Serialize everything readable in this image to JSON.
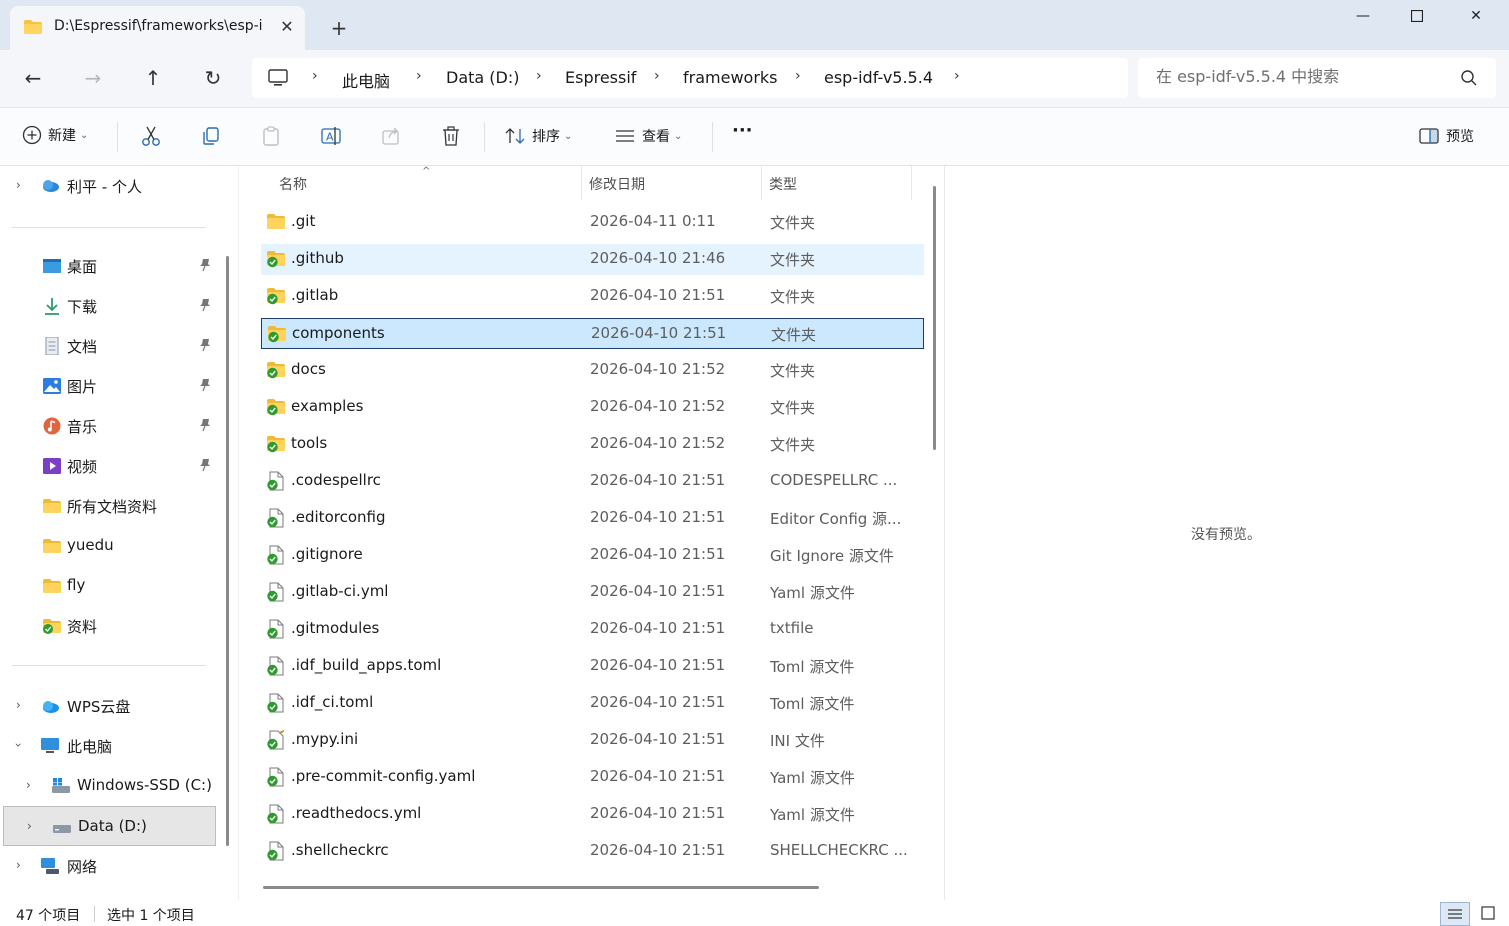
{
  "window": {
    "tab_title": "D:\\Espressif\\frameworks\\esp-i",
    "tab_close": "✕",
    "new_tab": "+",
    "minimize": "—",
    "maximize": "☐",
    "close": "✕"
  },
  "nav": {
    "back": "←",
    "forward": "→",
    "up": "↑",
    "refresh": "↻"
  },
  "breadcrumb": {
    "items": [
      "此电脑",
      "Data (D:)",
      "Espressif",
      "frameworks",
      "esp-idf-v5.5.4"
    ],
    "separator": "›"
  },
  "search": {
    "placeholder": "在 esp-idf-v5.5.4 中搜索"
  },
  "toolbar": {
    "new_label": "新建",
    "sort_label": "排序",
    "view_label": "查看",
    "more_label": "···",
    "preview_label": "预览",
    "chevron": "⌄"
  },
  "sidebar": {
    "onedrive": "利平 - 个人",
    "quick": [
      {
        "label": "桌面",
        "icon": "desktop-icon",
        "pinned": true
      },
      {
        "label": "下载",
        "icon": "download-icon",
        "pinned": true
      },
      {
        "label": "文档",
        "icon": "document-icon",
        "pinned": true
      },
      {
        "label": "图片",
        "icon": "pictures-icon",
        "pinned": true
      },
      {
        "label": "音乐",
        "icon": "music-icon",
        "pinned": true
      },
      {
        "label": "视频",
        "icon": "video-icon",
        "pinned": true
      },
      {
        "label": "所有文档资料",
        "icon": "folder-icon",
        "pinned": false
      },
      {
        "label": "yuedu",
        "icon": "folder-icon",
        "pinned": false
      },
      {
        "label": "fly",
        "icon": "folder-icon",
        "pinned": false
      },
      {
        "label": "资料",
        "icon": "folder-synced-icon",
        "pinned": false
      }
    ],
    "wps": "WPS云盘",
    "this_pc": "此电脑",
    "drive_c": "Windows-SSD (C:)",
    "drive_d": "Data (D:)",
    "network": "网络"
  },
  "columns": {
    "name": "名称",
    "modified": "修改日期",
    "type": "类型"
  },
  "files": [
    {
      "name": ".git",
      "date": "2026-04-11 0:11",
      "type": "文件夹",
      "kind": "folder"
    },
    {
      "name": ".github",
      "date": "2026-04-10 21:46",
      "type": "文件夹",
      "kind": "folder-synced"
    },
    {
      "name": ".gitlab",
      "date": "2026-04-10 21:51",
      "type": "文件夹",
      "kind": "folder-synced"
    },
    {
      "name": "components",
      "date": "2026-04-10 21:51",
      "type": "文件夹",
      "kind": "folder-synced"
    },
    {
      "name": "docs",
      "date": "2026-04-10 21:52",
      "type": "文件夹",
      "kind": "folder-synced"
    },
    {
      "name": "examples",
      "date": "2026-04-10 21:52",
      "type": "文件夹",
      "kind": "folder-synced"
    },
    {
      "name": "tools",
      "date": "2026-04-10 21:52",
      "type": "文件夹",
      "kind": "folder-synced"
    },
    {
      "name": ".codespellrc",
      "date": "2026-04-10 21:51",
      "type": "CODESPELLRC ...",
      "kind": "file"
    },
    {
      "name": ".editorconfig",
      "date": "2026-04-10 21:51",
      "type": "Editor Config 源...",
      "kind": "file"
    },
    {
      "name": ".gitignore",
      "date": "2026-04-10 21:51",
      "type": "Git Ignore 源文件",
      "kind": "file"
    },
    {
      "name": ".gitlab-ci.yml",
      "date": "2026-04-10 21:51",
      "type": "Yaml 源文件",
      "kind": "file"
    },
    {
      "name": ".gitmodules",
      "date": "2026-04-10 21:51",
      "type": "txtfile",
      "kind": "file"
    },
    {
      "name": ".idf_build_apps.toml",
      "date": "2026-04-10 21:51",
      "type": "Toml 源文件",
      "kind": "file"
    },
    {
      "name": ".idf_ci.toml",
      "date": "2026-04-10 21:51",
      "type": "Toml 源文件",
      "kind": "file"
    },
    {
      "name": ".mypy.ini",
      "date": "2026-04-10 21:51",
      "type": "INI 文件",
      "kind": "file-ini"
    },
    {
      "name": ".pre-commit-config.yaml",
      "date": "2026-04-10 21:51",
      "type": "Yaml 源文件",
      "kind": "file"
    },
    {
      "name": ".readthedocs.yml",
      "date": "2026-04-10 21:51",
      "type": "Yaml 源文件",
      "kind": "file"
    },
    {
      "name": ".shellcheckrc",
      "date": "2026-04-10 21:51",
      "type": "SHELLCHECKRC ...",
      "kind": "file"
    }
  ],
  "selected_file": "components",
  "hovered_file": ".github",
  "preview": {
    "empty_text": "没有预览。"
  },
  "status": {
    "count": "47 个项目",
    "selected": "选中 1 个项目"
  },
  "colors": {
    "selected_bg": "#cce8ff",
    "hover_bg": "#e5f3ff",
    "folder": "#f5c542",
    "sync_green": "#2e9b2e"
  }
}
